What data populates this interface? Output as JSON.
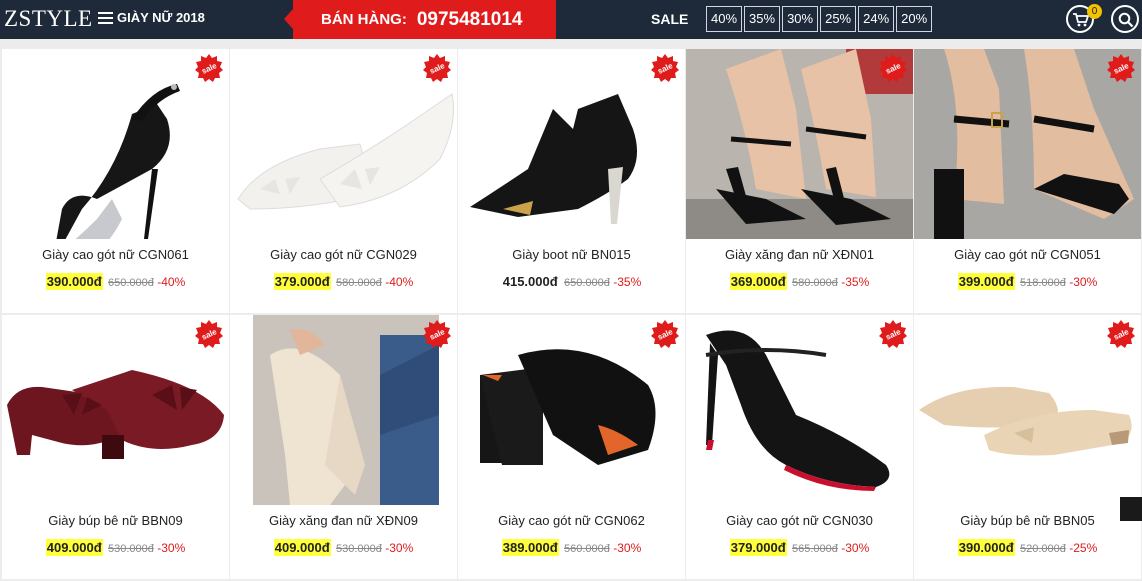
{
  "header": {
    "logo": "ZSTYLE",
    "menu_label": "GIÀY NỮ 2018",
    "hotline_label": "BÁN HÀNG:",
    "hotline_number": "0975481014",
    "sale_label": "SALE",
    "sale_tags": [
      "40%",
      "35%",
      "30%",
      "25%",
      "24%",
      "20%"
    ],
    "cart_count": "0",
    "colors": {
      "bar": "#1e2a39",
      "hotline": "#e01b1b",
      "badge": "#f3c200"
    }
  },
  "sale_badge_text": "sale",
  "products": [
    {
      "name": "Giày cao gót nữ CGN061",
      "price": "390.000đ",
      "old_price": "650.000đ",
      "discount": "-40%",
      "image": "black-silver-heel"
    },
    {
      "name": "Giày cao gót nữ CGN029",
      "price": "379.000đ",
      "old_price": "580.000đ",
      "discount": "-40%",
      "image": "white-bow-wedge"
    },
    {
      "name": "Giày boot nữ BN015",
      "price": "415.000đ",
      "old_price": "650.000đ",
      "discount": "-35%",
      "image": "black-ankle-boot"
    },
    {
      "name": "Giày xăng đan nữ XĐN01",
      "price": "369.000đ",
      "old_price": "580.000đ",
      "discount": "-35%",
      "image": "black-strap-sandal"
    },
    {
      "name": "Giày cao gót nữ CGN051",
      "price": "399.000đ",
      "old_price": "518.000đ",
      "discount": "-30%",
      "image": "black-block-sandal"
    },
    {
      "name": "Giày búp bê nữ BBN09",
      "price": "409.000đ",
      "old_price": "530.000đ",
      "discount": "-30%",
      "image": "burgundy-bow-loafer"
    },
    {
      "name": "Giày xăng đan nữ XĐN09",
      "price": "409.000đ",
      "old_price": "530.000đ",
      "discount": "-30%",
      "image": "beige-peep-toe"
    },
    {
      "name": "Giày cao gót nữ CGN062",
      "price": "389.000đ",
      "old_price": "560.000đ",
      "discount": "-30%",
      "image": "black-mule-heel"
    },
    {
      "name": "Giày cao gót nữ CGN030",
      "price": "379.000đ",
      "old_price": "565.000đ",
      "discount": "-30%",
      "image": "black-red-sole-pump"
    },
    {
      "name": "Giày búp bê nữ BBN05",
      "price": "390.000đ",
      "old_price": "520.000đ",
      "discount": "-25%",
      "image": "nude-flat"
    }
  ]
}
